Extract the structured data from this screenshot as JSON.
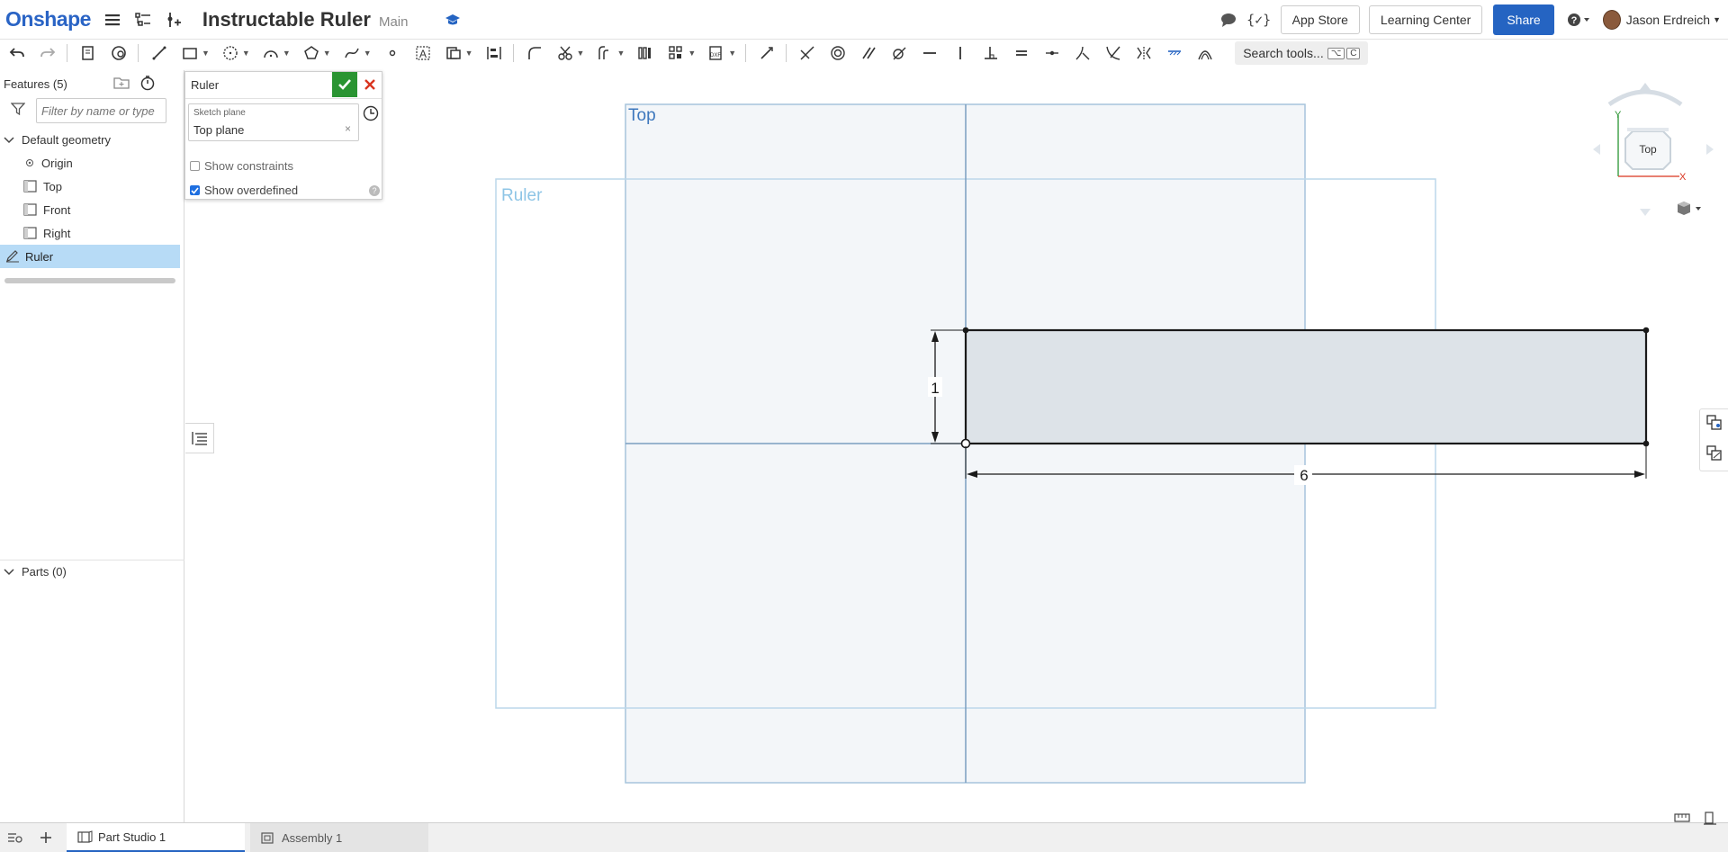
{
  "app": {
    "logo": "Onshape",
    "document_title": "Instructable Ruler",
    "branch": "Main"
  },
  "topbar": {
    "app_store": "App Store",
    "learning_center": "Learning Center",
    "share": "Share",
    "user_name": "Jason Erdreich"
  },
  "toolbar": {
    "search_label": "Search tools...",
    "search_shortcut_mod": "⌥",
    "search_shortcut_key": "C"
  },
  "features": {
    "header": "Features (5)",
    "filter_placeholder": "Filter by name or type",
    "default_geometry": "Default geometry",
    "items": [
      {
        "label": "Origin",
        "icon": "origin-icon"
      },
      {
        "label": "Top",
        "icon": "plane-icon"
      },
      {
        "label": "Front",
        "icon": "plane-icon"
      },
      {
        "label": "Right",
        "icon": "plane-icon"
      }
    ],
    "selected": "Ruler",
    "parts": "Parts (0)"
  },
  "sketch_dialog": {
    "title": "Ruler",
    "field_label": "Sketch plane",
    "field_value": "Top plane",
    "clear": "×",
    "show_constraints": "Show constraints",
    "show_constraints_checked": false,
    "show_overdefined": "Show overdefined",
    "show_overdefined_checked": true,
    "help": "?"
  },
  "viewport": {
    "top_plane_label": "Top",
    "sketch_label": "Ruler",
    "dim_height": "1",
    "dim_width": "6",
    "view_cube_face": "Top",
    "axis_y": "Y",
    "axis_x": "X"
  },
  "tabs": [
    {
      "label": "Part Studio 1",
      "active": true
    },
    {
      "label": "Assembly 1",
      "active": false
    }
  ],
  "colors": {
    "brand_blue": "#2564c2",
    "ok_green": "#2a9432",
    "cancel_red": "#d9341f",
    "plane_fill": "#f3f6f9",
    "plane_stroke": "#a6c4dc",
    "sketch_fill": "#dde3e8"
  }
}
